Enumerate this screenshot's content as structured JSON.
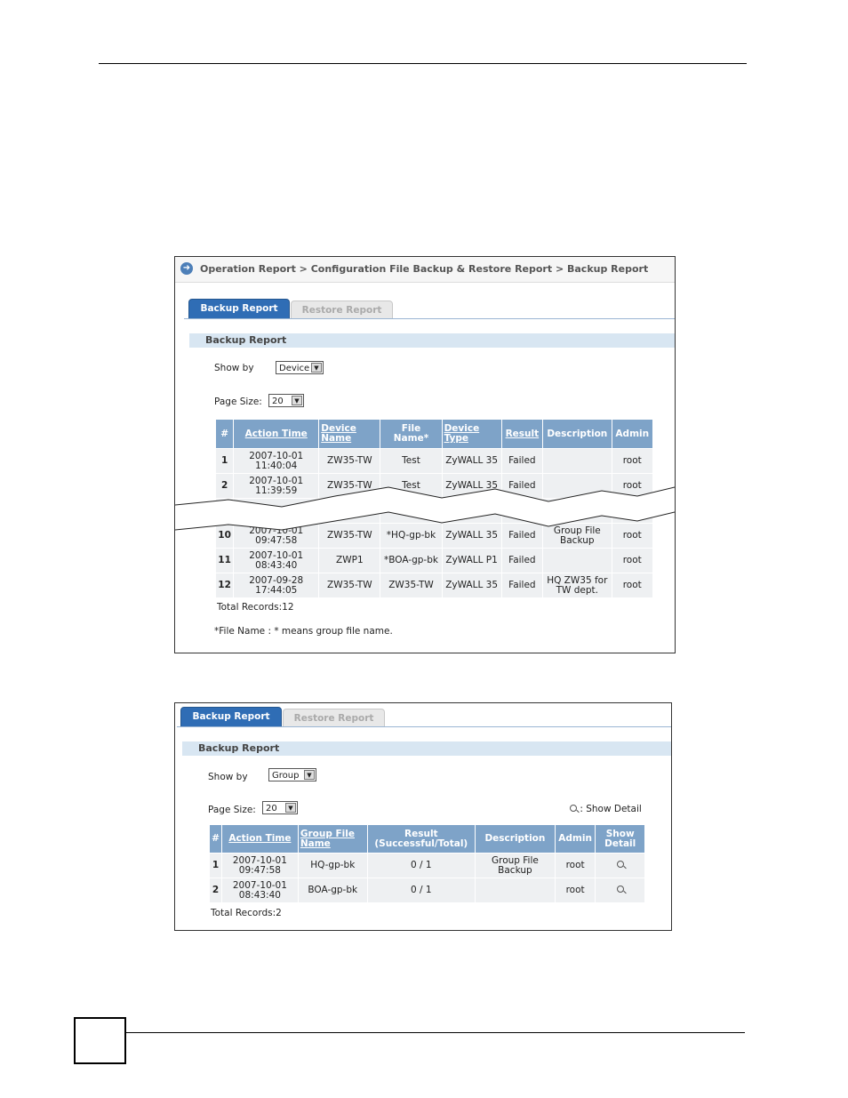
{
  "shot1": {
    "breadcrumb": "Operation Report > Configuration File Backup & Restore Report > Backup Report",
    "tabs": {
      "active": "Backup Report",
      "inactive": "Restore Report"
    },
    "section_title": "Backup Report",
    "show_by_label": "Show by",
    "show_by_value": "Device",
    "page_size_label": "Page Size:",
    "page_size_value": "20",
    "columns": {
      "num": "#",
      "action_time": "Action Time",
      "device_name": "Device Name",
      "file_name": "File Name*",
      "device_type": "Device Type",
      "result": "Result",
      "description": "Description",
      "admin": "Admin"
    },
    "rows": [
      {
        "num": "1",
        "date": "2007-10-01",
        "time": "11:40:04",
        "device": "ZW35-TW",
        "file": "Test",
        "type": "ZyWALL 35",
        "result": "Failed",
        "desc1": "",
        "desc2": "",
        "admin": "root"
      },
      {
        "num": "2",
        "date": "2007-10-01",
        "time": "11:39:59",
        "device": "ZW35-TW",
        "file": "Test",
        "type": "ZyWALL 35",
        "result": "Failed",
        "desc1": "",
        "desc2": "",
        "admin": "root"
      },
      {
        "num": "10",
        "date": "2007-10-01",
        "time": "09:47:58",
        "device": "ZW35-TW",
        "file": "*HQ-gp-bk",
        "type": "ZyWALL 35",
        "result": "Failed",
        "desc1": "Group File",
        "desc2": "Backup",
        "admin": "root"
      },
      {
        "num": "11",
        "date": "2007-10-01",
        "time": "08:43:40",
        "device": "ZWP1",
        "file": "*BOA-gp-bk",
        "type": "ZyWALL P1",
        "result": "Failed",
        "desc1": "",
        "desc2": "",
        "admin": "root"
      },
      {
        "num": "12",
        "date": "2007-09-28",
        "time": "17:44:05",
        "device": "ZW35-TW",
        "file": "ZW35-TW",
        "type": "ZyWALL 35",
        "result": "Failed",
        "desc1": "HQ ZW35 for",
        "desc2": "TW dept.",
        "admin": "root"
      }
    ],
    "total_records": "Total Records:12",
    "footnote": "*File Name : * means group file name."
  },
  "shot2": {
    "tabs": {
      "active": "Backup Report",
      "inactive": "Restore Report"
    },
    "section_title": "Backup Report",
    "show_by_label": "Show by",
    "show_by_value": "Group",
    "page_size_label": "Page Size:",
    "page_size_value": "20",
    "show_detail_label": ": Show Detail",
    "columns": {
      "num": "#",
      "action_time": "Action Time",
      "group_file_name": "Group File Name",
      "result_l1": "Result",
      "result_l2": "(Successful/Total)",
      "description": "Description",
      "admin": "Admin",
      "show_detail": "Show Detail"
    },
    "rows": [
      {
        "num": "1",
        "date": "2007-10-01",
        "time": "09:47:58",
        "group": "HQ-gp-bk",
        "result": "0 / 1",
        "desc1": "Group File",
        "desc2": "Backup",
        "admin": "root"
      },
      {
        "num": "2",
        "date": "2007-10-01",
        "time": "08:43:40",
        "group": "BOA-gp-bk",
        "result": "0 / 1",
        "desc1": "",
        "desc2": "",
        "admin": "root"
      }
    ],
    "total_records": "Total Records:2"
  }
}
